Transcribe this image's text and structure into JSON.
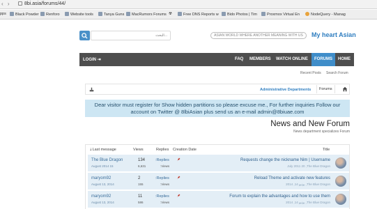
{
  "browser": {
    "nav_glyphs": "‹ ›",
    "url": "8bi.asia/forums/44/",
    "bookmarks": [
      {
        "label": "pps"
      },
      {
        "label": "Black Powder"
      },
      {
        "label": "Renforo"
      },
      {
        "label": "Website tools"
      },
      {
        "label": "Tanya Guns"
      },
      {
        "label": "MacRumors Forums"
      },
      {
        "label": ""
      },
      {
        "label": "Free DNS Reports w"
      },
      {
        "label": "Bido Photos | Tim"
      },
      {
        "label": "Proxmox Virtual En"
      },
      {
        "label": "NodeQuery - Manag"
      }
    ]
  },
  "header": {
    "search_placeholder": "البحث...",
    "slogan": "ASIAN WORLD WHERE ANOTHER MEANING WITH US",
    "site_title": "My heart Asian"
  },
  "navbar": {
    "login": "LOGIN ⇥",
    "items": [
      "FAQ",
      "MEMBERS",
      "WATCH ONLINE",
      "FORUMS",
      "HOME"
    ],
    "active": "FORUMS",
    "active_color": "#3f8dc9",
    "bar_color": "#4e4e4e",
    "sub_links": [
      "Recent Posts",
      "Search Forum"
    ]
  },
  "breadcrumb": {
    "section": "Administrative Departments",
    "forums": "Forums"
  },
  "notice": "Dear visitor must register for Show hidden partitions so please excuse me., For further inquiries Follow our account on Twitter @ 8lbiAsian plus send us an e-mail admin@8biuae.com",
  "page": {
    "title": "News and New Forum",
    "subtitle": "News department specializes Forum"
  },
  "table": {
    "headers": {
      "last_message": "⇣Last message",
      "views": "Views",
      "replies": "Replies",
      "creation_date": "Creation Date",
      "title": "Title"
    },
    "rows": [
      {
        "author": "The Blue Dragon",
        "date": "August 2014 15",
        "replies": "134",
        "views": "6,631",
        "replies_label": ":Replies",
        "views_label": ":Views",
        "title": "Requests change the nickname Nim | Username",
        "meta": "July 2011 20 ,The Blue Dragon"
      },
      {
        "author": "maryom92",
        "date": "August 13, 2014",
        "replies": "2",
        "views": "155",
        "replies_label": ":Replies",
        "views_label": ":Views",
        "title": "Reload Theme and activate new features",
        "meta": "2014 ,يونيو 14 ,The Blue Dragon"
      },
      {
        "author": "maryom92",
        "date": "August 13, 2014",
        "replies": "11",
        "views": "586",
        "replies_label": ":Replies",
        "views_label": ":Views",
        "title": "Forum to explain the advantages and how to use them",
        "meta": "2014 ,يونيو 14 ,The Blue Dragon"
      }
    ]
  }
}
